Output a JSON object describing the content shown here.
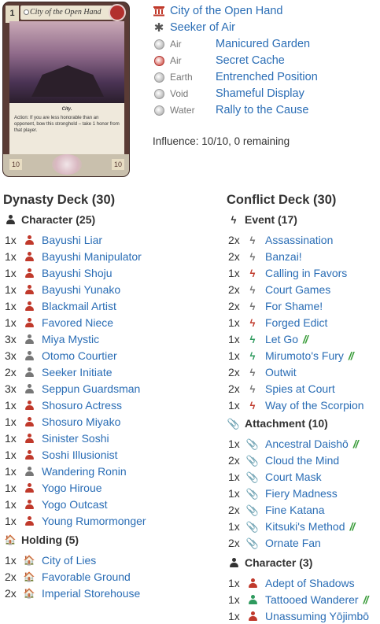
{
  "card": {
    "title": "City of the Open Hand",
    "bonus": "1",
    "trait": "City.",
    "text": "Action: If you are less honorable than an opponent, bow this stronghold – take 1 honor from that player.",
    "stat_left": "10",
    "stat_right": "10"
  },
  "stronghold": {
    "name": "City of the Open Hand",
    "role": "Seeker of Air",
    "provinces": [
      {
        "element": "Air",
        "name": "Manicured Garden",
        "icon": "air-ring-icon"
      },
      {
        "element": "Air",
        "name": "Secret Cache",
        "icon": "fire-ring-icon"
      },
      {
        "element": "Earth",
        "name": "Entrenched Position",
        "icon": "earth-ring-icon"
      },
      {
        "element": "Void",
        "name": "Shameful Display",
        "icon": "void-ring-icon"
      },
      {
        "element": "Water",
        "name": "Rally to the Cause",
        "icon": "water-ring-icon"
      }
    ],
    "influence": "Influence: 10/10, 0 remaining"
  },
  "dynasty": {
    "title": "Dynasty Deck (30)",
    "character_title": "Character (25)",
    "characters": [
      {
        "qty": "1x",
        "name": "Bayushi Liar",
        "color": "red"
      },
      {
        "qty": "1x",
        "name": "Bayushi Manipulator",
        "color": "red"
      },
      {
        "qty": "1x",
        "name": "Bayushi Shoju",
        "color": "red"
      },
      {
        "qty": "1x",
        "name": "Bayushi Yunako",
        "color": "red"
      },
      {
        "qty": "1x",
        "name": "Blackmail Artist",
        "color": "red"
      },
      {
        "qty": "1x",
        "name": "Favored Niece",
        "color": "red"
      },
      {
        "qty": "3x",
        "name": "Miya Mystic",
        "color": "gray"
      },
      {
        "qty": "3x",
        "name": "Otomo Courtier",
        "color": "gray"
      },
      {
        "qty": "2x",
        "name": "Seeker Initiate",
        "color": "gray"
      },
      {
        "qty": "3x",
        "name": "Seppun Guardsman",
        "color": "gray"
      },
      {
        "qty": "1x",
        "name": "Shosuro Actress",
        "color": "red"
      },
      {
        "qty": "1x",
        "name": "Shosuro Miyako",
        "color": "red"
      },
      {
        "qty": "1x",
        "name": "Sinister Soshi",
        "color": "red"
      },
      {
        "qty": "1x",
        "name": "Soshi Illusionist",
        "color": "red"
      },
      {
        "qty": "1x",
        "name": "Wandering Ronin",
        "color": "gray"
      },
      {
        "qty": "1x",
        "name": "Yogo Hiroue",
        "color": "red"
      },
      {
        "qty": "1x",
        "name": "Yogo Outcast",
        "color": "red"
      },
      {
        "qty": "1x",
        "name": "Young Rumormonger",
        "color": "red"
      }
    ],
    "holding_title": "Holding (5)",
    "holdings": [
      {
        "qty": "1x",
        "name": "City of Lies",
        "color": "red"
      },
      {
        "qty": "2x",
        "name": "Favorable Ground",
        "color": "gray"
      },
      {
        "qty": "2x",
        "name": "Imperial Storehouse",
        "color": "gray"
      }
    ]
  },
  "conflict": {
    "title": "Conflict Deck (30)",
    "event_title": "Event (17)",
    "events": [
      {
        "qty": "2x",
        "name": "Assassination",
        "color": "gray",
        "mark": ""
      },
      {
        "qty": "2x",
        "name": "Banzai!",
        "color": "gray",
        "mark": ""
      },
      {
        "qty": "1x",
        "name": "Calling in Favors",
        "color": "red",
        "mark": ""
      },
      {
        "qty": "2x",
        "name": "Court Games",
        "color": "gray",
        "mark": ""
      },
      {
        "qty": "2x",
        "name": "For Shame!",
        "color": "gray",
        "mark": ""
      },
      {
        "qty": "1x",
        "name": "Forged Edict",
        "color": "red",
        "mark": ""
      },
      {
        "qty": "1x",
        "name": "Let Go",
        "color": "green",
        "mark": "//"
      },
      {
        "qty": "1x",
        "name": "Mirumoto's Fury",
        "color": "green",
        "mark": "//"
      },
      {
        "qty": "2x",
        "name": "Outwit",
        "color": "gray",
        "mark": ""
      },
      {
        "qty": "2x",
        "name": "Spies at Court",
        "color": "gray",
        "mark": ""
      },
      {
        "qty": "1x",
        "name": "Way of the Scorpion",
        "color": "red",
        "mark": ""
      }
    ],
    "attachment_title": "Attachment (10)",
    "attachments": [
      {
        "qty": "1x",
        "name": "Ancestral Daishō",
        "color": "green",
        "mark": "//"
      },
      {
        "qty": "2x",
        "name": "Cloud the Mind",
        "color": "gray",
        "mark": ""
      },
      {
        "qty": "1x",
        "name": "Court Mask",
        "color": "red",
        "mark": ""
      },
      {
        "qty": "1x",
        "name": "Fiery Madness",
        "color": "red",
        "mark": ""
      },
      {
        "qty": "2x",
        "name": "Fine Katana",
        "color": "gray",
        "mark": ""
      },
      {
        "qty": "1x",
        "name": "Kitsuki's Method",
        "color": "green",
        "mark": "//"
      },
      {
        "qty": "2x",
        "name": "Ornate Fan",
        "color": "gray",
        "mark": ""
      }
    ],
    "character_title": "Character (3)",
    "characters": [
      {
        "qty": "1x",
        "name": "Adept of Shadows",
        "color": "red",
        "mark": ""
      },
      {
        "qty": "1x",
        "name": "Tattooed Wanderer",
        "color": "green",
        "mark": "//"
      },
      {
        "qty": "1x",
        "name": "Unassuming Yōjimbō",
        "color": "red",
        "mark": ""
      }
    ]
  },
  "colors": {
    "link": "#2a6db5",
    "red": "#c0392b",
    "gray": "#777777",
    "green": "#2e9a5e"
  }
}
